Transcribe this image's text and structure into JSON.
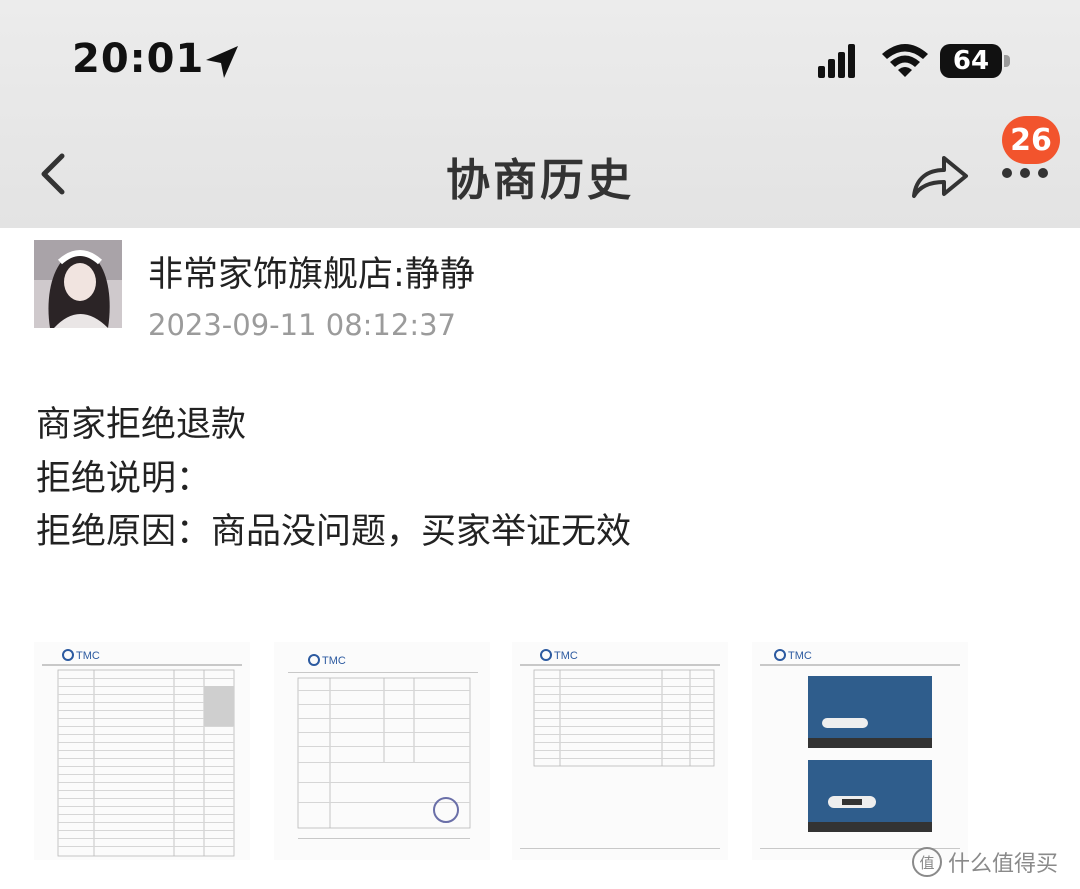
{
  "status_bar": {
    "time": "20:01",
    "battery_level": "64",
    "icons": [
      "location-arrow-icon",
      "cellular-signal-icon",
      "wifi-icon",
      "battery-icon"
    ]
  },
  "header": {
    "title": "协商历史",
    "badge_count": "26",
    "icons": [
      "back-chevron-icon",
      "share-icon",
      "more-icon"
    ]
  },
  "message": {
    "sender": "非常家饰旗舰店:静静",
    "timestamp": "2023-09-11 08:12:37",
    "lines": [
      "商家拒绝退款",
      "拒绝说明：",
      "拒绝原因：商品没问题，买家举证无效"
    ]
  },
  "attachments": [
    {
      "logo": "TMC",
      "kind": "report-table"
    },
    {
      "logo": "TMC",
      "kind": "report-form"
    },
    {
      "logo": "TMC",
      "kind": "report-table"
    },
    {
      "logo": "TMC",
      "kind": "report-photos"
    }
  ],
  "watermark": {
    "icon_text": "值",
    "text": "什么值得买"
  }
}
